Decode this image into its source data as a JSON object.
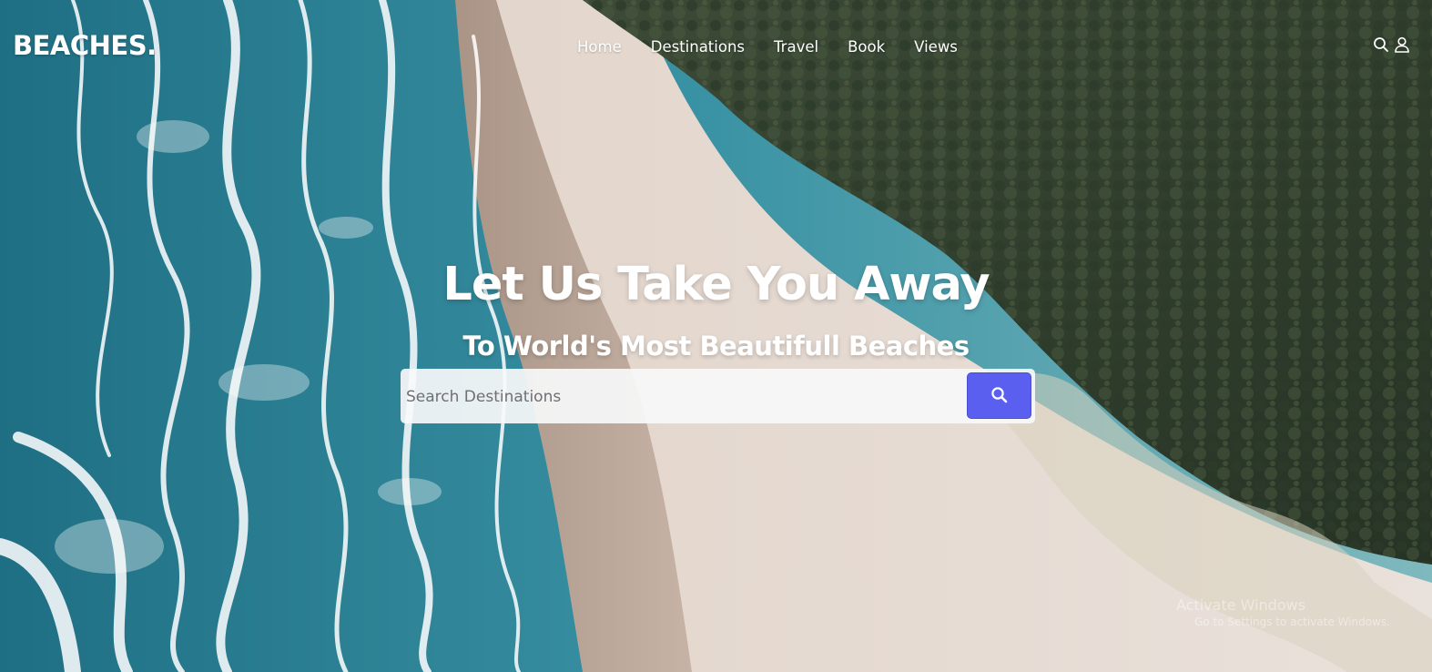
{
  "brand": {
    "logo_text": "BEACHES."
  },
  "nav": {
    "links": [
      "Home",
      "Destinations",
      "Travel",
      "Book",
      "Views"
    ],
    "icons": [
      "search-icon",
      "user-icon"
    ]
  },
  "hero": {
    "headline": "Let Us Take You Away",
    "subheadline": "To World's Most Beautifull Beaches"
  },
  "search": {
    "placeholder": "Search Destinations",
    "value": "",
    "button_icon": "search-icon",
    "button_color": "#5b5ff0"
  },
  "os_watermark": {
    "title": "Activate Windows",
    "subtitle": "Go to Settings to activate Windows."
  },
  "colors": {
    "accent": "#5b5ff0",
    "text": "#ffffff",
    "ocean": "#2f8a9c",
    "sand": "#e4dcd6",
    "forest": "#34422f"
  }
}
